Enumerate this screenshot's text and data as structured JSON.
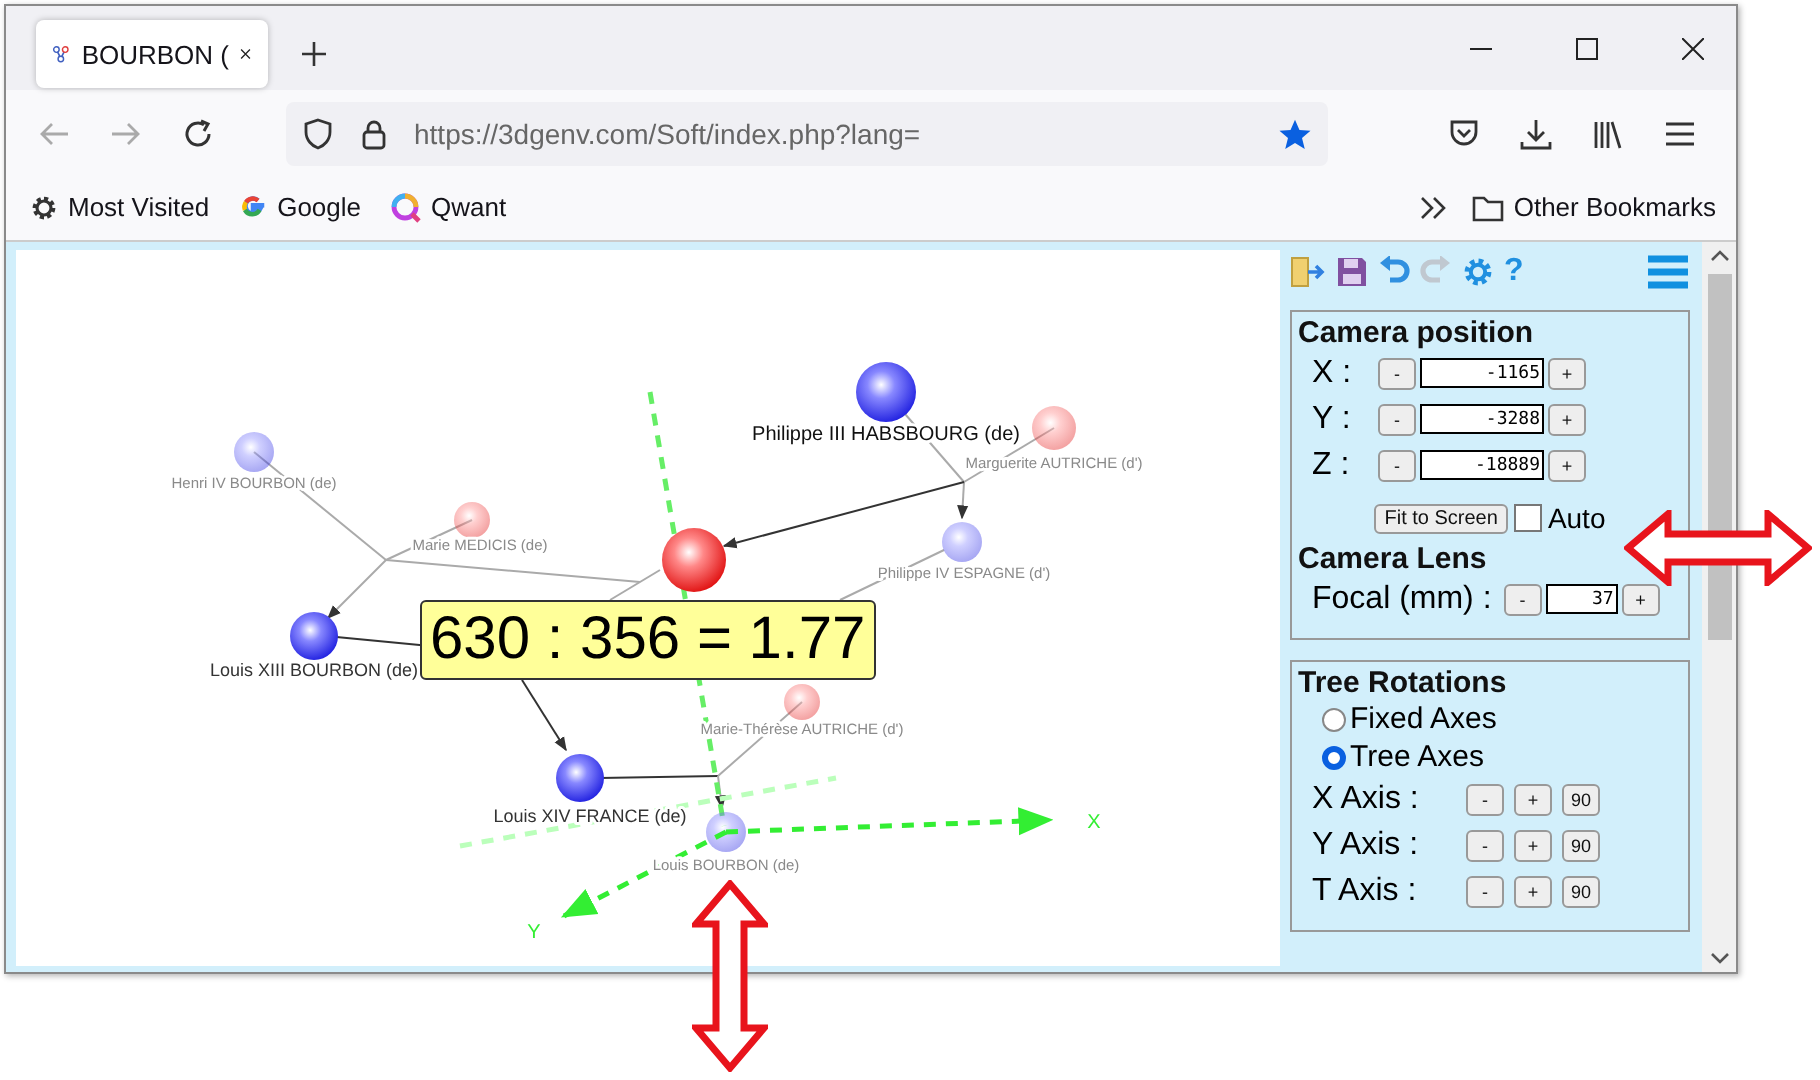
{
  "tab": {
    "title": "BOURBON ("
  },
  "address_bar": {
    "url": "https://3dgenv.com/Soft/index.php?lang="
  },
  "bookmarks": [
    {
      "label": "Most Visited",
      "kind": "gear"
    },
    {
      "label": "Google",
      "kind": "google"
    },
    {
      "label": "Qwant",
      "kind": "qwant"
    }
  ],
  "other_bookmarks": "Other Bookmarks",
  "graph": {
    "nodes": [
      {
        "name": "Henri IV BOURBON (de)",
        "kind": "man",
        "dimmed": true
      },
      {
        "name": "Marie MEDICIS (de)",
        "kind": "woman",
        "dimmed": true
      },
      {
        "name": "Louis XIII BOURBON (de)",
        "kind": "man",
        "dimmed": false
      },
      {
        "name": "Philippe III HABSBOURG (de)",
        "kind": "man",
        "dimmed": false
      },
      {
        "name": "Marguerite AUTRICHE (d')",
        "kind": "woman",
        "dimmed": true
      },
      {
        "name": "Philippe IV ESPAGNE (d')",
        "kind": "man",
        "dimmed": true
      },
      {
        "kind": "woman",
        "dimmed": false
      },
      {
        "name": "Marie-Thérèse AUTRICHE (d')",
        "kind": "woman",
        "dimmed": true
      },
      {
        "name": "Louis XIV FRANCE (de)",
        "kind": "man",
        "dimmed": false
      },
      {
        "name": "Louis BOURBON (de)",
        "kind": "man",
        "dimmed": true
      }
    ],
    "axes": [
      "X",
      "Y"
    ],
    "ratio": "630 : 356 = 1.77"
  },
  "panel": {
    "help": "?",
    "camera_title": "Camera position",
    "coords": [
      {
        "label": "X :",
        "value": "-1165"
      },
      {
        "label": "Y :",
        "value": "-3288"
      },
      {
        "label": "Z :",
        "value": "-18889"
      }
    ],
    "minus": "-",
    "plus": "+",
    "fit_button": "Fit to Screen",
    "auto": {
      "label": "Auto",
      "checked": false
    },
    "lens_title": "Camera Lens",
    "focal": {
      "label": "Focal (mm) :",
      "value": "37"
    },
    "rotations_title": "Tree Rotations",
    "modes": [
      {
        "label": "Fixed Axes",
        "selected": false
      },
      {
        "label": "Tree Axes",
        "selected": true
      }
    ],
    "axes": [
      {
        "label": "X Axis :",
        "step": "90"
      },
      {
        "label": "Y Axis :",
        "step": "90"
      },
      {
        "label": "T Axis :",
        "step": "90"
      }
    ]
  }
}
